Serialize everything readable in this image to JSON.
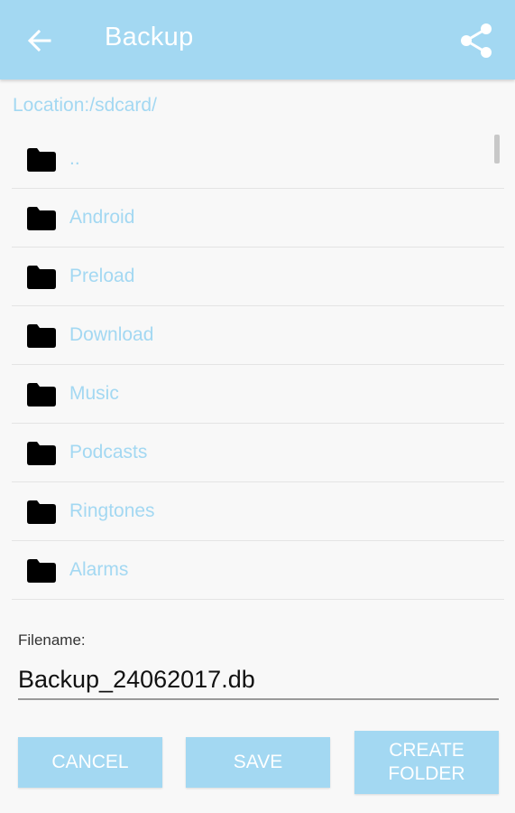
{
  "toolbar": {
    "title": "Backup",
    "back_icon": "arrow-left-icon",
    "share_icon": "share-icon"
  },
  "location": {
    "text": "Location:/sdcard/"
  },
  "files": [
    {
      "name": ".."
    },
    {
      "name": "Android"
    },
    {
      "name": "Preload"
    },
    {
      "name": "Download"
    },
    {
      "name": "Music"
    },
    {
      "name": "Podcasts"
    },
    {
      "name": "Ringtones"
    },
    {
      "name": "Alarms"
    }
  ],
  "filename": {
    "label": "Filename:",
    "value": "Backup_24062017.db"
  },
  "buttons": {
    "cancel": "CANCEL",
    "save": "SAVE",
    "create_line1": "CREATE",
    "create_line2": "FOLDER"
  },
  "colors": {
    "accent": "#a3d8f2",
    "background": "#f8f8f8",
    "divider": "#e4e4e4"
  }
}
